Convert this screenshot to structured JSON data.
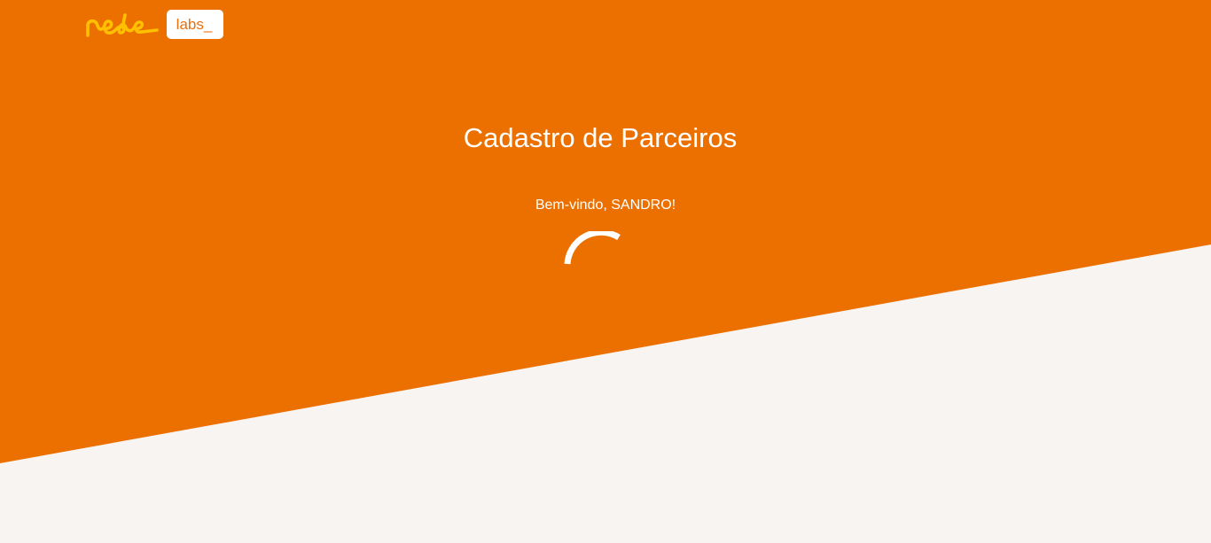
{
  "brand": {
    "logo": "rede",
    "badge_label": "labs_"
  },
  "main": {
    "title": "Cadastro de Parceiros",
    "welcome": "Bem-vindo, SANDRO!",
    "loading_indicator": "spinner-icon"
  },
  "colors": {
    "primary_orange": "#ec7000",
    "background_light": "#f8f4f2",
    "logo_yellow": "#ffc000",
    "text_on_orange": "#ffffff"
  }
}
